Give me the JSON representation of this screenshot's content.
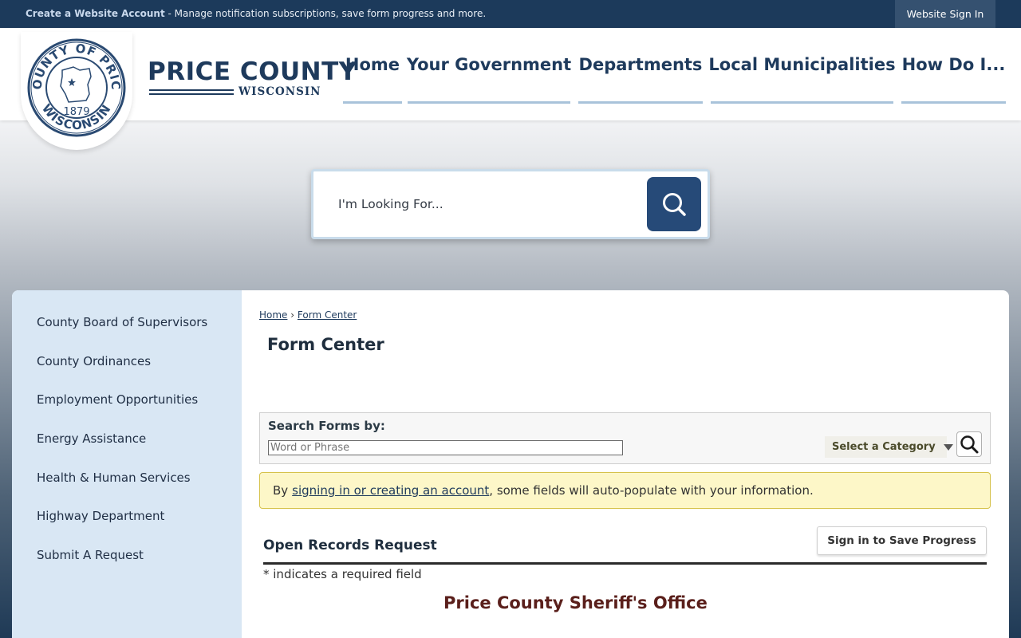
{
  "topbar": {
    "create_account_link": "Create a Website Account",
    "message": " - Manage notification subscriptions, save form progress and more.",
    "sign_in": "Website Sign In"
  },
  "seal": {
    "top_text": "COUNTY OF PRICE",
    "bottom_text": "WISCONSIN",
    "year": "1879"
  },
  "brand": {
    "name": "PRICE COUNTY",
    "sub": "WISCONSIN"
  },
  "nav": [
    {
      "label": "Home"
    },
    {
      "label": "Your Government"
    },
    {
      "label": "Departments"
    },
    {
      "label": "Local Municipalities"
    },
    {
      "label": "How Do I..."
    }
  ],
  "search": {
    "placeholder": "I'm Looking For..."
  },
  "sidebar": {
    "items": [
      {
        "label": "County Board of Supervisors"
      },
      {
        "label": "County Ordinances"
      },
      {
        "label": "Employment Opportunities"
      },
      {
        "label": "Energy Assistance"
      },
      {
        "label": "Health & Human Services"
      },
      {
        "label": "Highway Department"
      },
      {
        "label": "Submit A Request"
      }
    ]
  },
  "breadcrumb": {
    "home": "Home",
    "separator": "›",
    "current": "Form Center"
  },
  "page_title": "Form Center",
  "search_forms": {
    "label": "Search Forms by:",
    "placeholder": "Word or Phrase",
    "category": "Select a Category"
  },
  "notice": {
    "prefix": "By",
    "link": "signing in or creating an account",
    "suffix": ", some fields will auto-populate with your information."
  },
  "form": {
    "title": "Open Records Request",
    "save_button": "Sign in to Save Progress",
    "required_note": "* indicates a required field",
    "office": "Price County Sheriff's Office"
  },
  "colors": {
    "topbar": "#1c3a5b",
    "brand": "#1e3a5c",
    "nav_underline": "#a9c3da",
    "search_button": "#264a78",
    "sidebar": "#d9e7f4",
    "notice_bg": "#fdf7c8",
    "office_text": "#5a1f1b"
  }
}
